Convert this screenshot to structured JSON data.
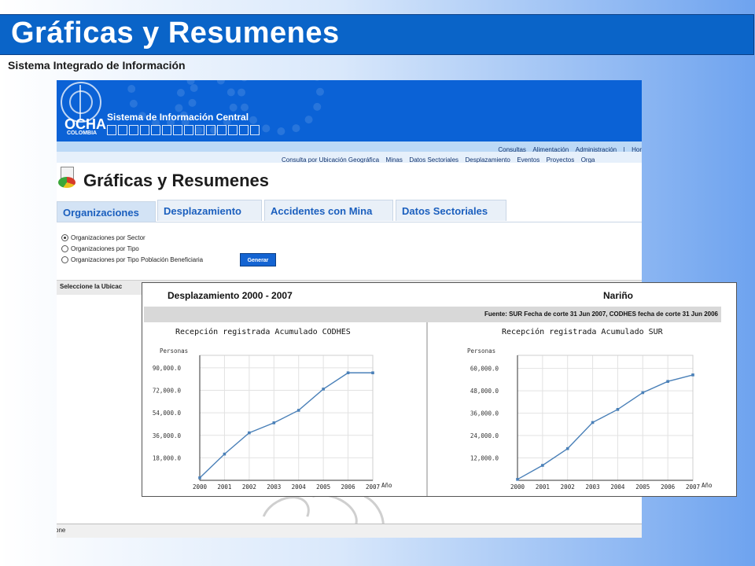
{
  "slide": {
    "title": "Gráficas y Resumenes",
    "subtitle": "Sistema Integrado de Información"
  },
  "banner": {
    "org_name": "OCHA",
    "org_country": "COLOMBIA",
    "system_title": "Sistema de Información Central",
    "logo_icon": "un-emblem-icon"
  },
  "menu_top": [
    "Consultas",
    "Alimentación",
    "Administración",
    "|",
    "Hor"
  ],
  "menu_main": [
    "Consulta por Ubicación Geográfica",
    "Minas",
    "Datos Sectoriales",
    "Desplazamiento",
    "Eventos",
    "Proyectos",
    "Orga"
  ],
  "page": {
    "title": "Gráficas y Resumenes",
    "icon": "chart-document-icon"
  },
  "tabs": [
    {
      "label": "Organizaciones",
      "active": true
    },
    {
      "label": "Desplazamiento",
      "active": false
    },
    {
      "label": "Accidentes con Mina",
      "active": false
    },
    {
      "label": "Datos Sectoriales",
      "active": false
    }
  ],
  "options": [
    {
      "label": "Organizaciones por Sector",
      "selected": true
    },
    {
      "label": "Organizaciones por Tipo",
      "selected": false
    },
    {
      "label": "Organizaciones por Tipo Población Beneficiaria",
      "selected": false
    }
  ],
  "generate_label": "Generar",
  "select_location_label": "Seleccione la Ubicac",
  "status_text": "one",
  "panel": {
    "title": "Desplazamiento 2000 - 2007",
    "region": "Nariño",
    "source": "Fuente: SUR Fecha de corte 31 Jun 2007, CODHES fecha de corte 31 Jun 2006"
  },
  "chart_data": [
    {
      "type": "line",
      "title": "Recepción registrada Acumulado CODHES",
      "ylabel": "Personas",
      "xlabel": "Año",
      "x": [
        "2000",
        "2001",
        "2002",
        "2003",
        "2004",
        "2005",
        "2006",
        "2007"
      ],
      "y_ticks": [
        "18,000.0",
        "36,000.0",
        "54,000.0",
        "72,000.0",
        "90,000.0"
      ],
      "y_tick_values": [
        18000,
        36000,
        54000,
        72000,
        90000
      ],
      "ylim": [
        0,
        100000
      ],
      "values": [
        2000,
        21000,
        38000,
        46000,
        56000,
        73000,
        86000,
        86000
      ],
      "grid": true,
      "color": "#4a80b8"
    },
    {
      "type": "line",
      "title": "Recepción registrada Acumulado SUR",
      "ylabel": "Personas",
      "xlabel": "Año",
      "x": [
        "2000",
        "2001",
        "2002",
        "2003",
        "2004",
        "2005",
        "2006",
        "2007"
      ],
      "y_ticks": [
        "12,000.0",
        "24,000.0",
        "36,000.0",
        "48,000.0",
        "60,000.0"
      ],
      "y_tick_values": [
        12000,
        24000,
        36000,
        48000,
        60000
      ],
      "ylim": [
        0,
        67000
      ],
      "values": [
        500,
        8000,
        17000,
        31000,
        38000,
        47000,
        53000,
        56500
      ],
      "grid": true,
      "color": "#4a80b8"
    }
  ]
}
